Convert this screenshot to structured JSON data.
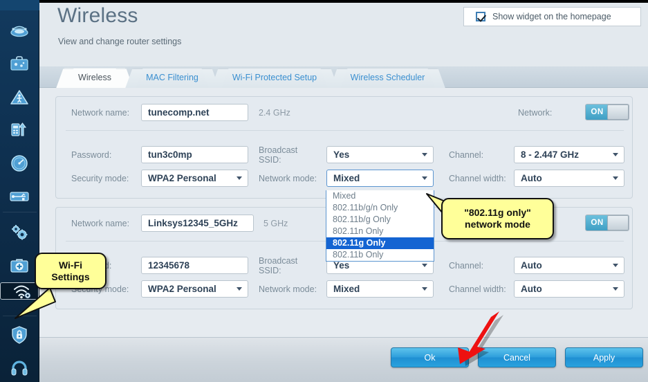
{
  "header": {
    "title": "Wireless",
    "subtitle": "View and change router settings",
    "widget_checkbox_label": "Show widget on the homepage",
    "widget_checked": true
  },
  "tabs": [
    {
      "label": "Wireless",
      "active": true
    },
    {
      "label": "MAC Filtering",
      "active": false
    },
    {
      "label": "Wi-Fi Protected Setup",
      "active": false
    },
    {
      "label": "Wireless Scheduler",
      "active": false
    }
  ],
  "networks": [
    {
      "band": "2.4 GHz",
      "network_name_label": "Network name:",
      "network_name_value": "tunecomp.net",
      "network_toggle_label": "Network:",
      "network_toggle_state": "ON",
      "password_label": "Password:",
      "password_value": "tun3c0mp",
      "security_label": "Security mode:",
      "security_value": "WPA2 Personal",
      "broadcast_label": "Broadcast SSID:",
      "broadcast_label_line1": "Broadcast",
      "broadcast_label_line2": "SSID:",
      "broadcast_value": "Yes",
      "network_mode_label": "Network mode:",
      "network_mode_value": "Mixed",
      "channel_label": "Channel:",
      "channel_value": "8 - 2.447 GHz",
      "channel_width_label": "Channel width:",
      "channel_width_value": "Auto"
    },
    {
      "band": "5 GHz",
      "network_name_label": "Network name:",
      "network_name_value": "Linksys12345_5GHz",
      "network_toggle_label": "",
      "network_toggle_state": "ON",
      "password_label": "Password:",
      "password_value": "12345678",
      "security_label": "Security mode:",
      "security_value": "WPA2 Personal",
      "broadcast_label_line1": "Broadcast",
      "broadcast_label_line2": "SSID:",
      "broadcast_value": "Yes",
      "network_mode_label": "Network mode:",
      "network_mode_value": "Mixed",
      "channel_label": "Channel:",
      "channel_value": "Auto",
      "channel_width_label": "Channel width:",
      "channel_width_value": "Auto"
    }
  ],
  "network_mode_dropdown": {
    "open": true,
    "options": [
      {
        "label": "Mixed",
        "selected": false
      },
      {
        "label": "802.11b/g/n Only",
        "selected": false
      },
      {
        "label": "802.11b/g Only",
        "selected": false
      },
      {
        "label": "802.11n Only",
        "selected": false
      },
      {
        "label": "802.11g Only",
        "selected": true
      },
      {
        "label": "802.11b Only",
        "selected": false
      }
    ]
  },
  "footer": {
    "ok_label": "Ok",
    "cancel_label": "Cancel",
    "apply_label": "Apply"
  },
  "callouts": [
    {
      "name": "network-mode-callout",
      "line1": "\"802.11g only\"",
      "line2": "network mode"
    },
    {
      "name": "wifi-settings-callout",
      "line1": "Wi-Fi",
      "line2": "Settings"
    }
  ],
  "sidebar": {
    "items": [
      {
        "icon": "router-icon",
        "selected": false
      },
      {
        "icon": "toolbox-icon",
        "selected": false
      },
      {
        "icon": "troubleshoot-warning-icon",
        "selected": false
      },
      {
        "icon": "device-transfer-icon",
        "selected": false
      },
      {
        "icon": "speed-gauge-icon",
        "selected": false
      },
      {
        "icon": "usb-connection-icon",
        "selected": false
      },
      {
        "icon": "gears-settings-icon",
        "selected": false
      },
      {
        "icon": "first-aid-kit-icon",
        "selected": false
      },
      {
        "icon": "wifi-settings-icon",
        "selected": true
      },
      {
        "icon": "shield-lock-icon",
        "selected": false
      },
      {
        "icon": "headset-support-icon",
        "selected": false
      }
    ]
  },
  "colors": {
    "accent_blue": "#2e9fdc",
    "sidebar_dark": "#0e2f4e",
    "callout_yellow": "#ffff99",
    "arrow_red": "#ee1111",
    "highlight_blue": "#1464d2"
  }
}
